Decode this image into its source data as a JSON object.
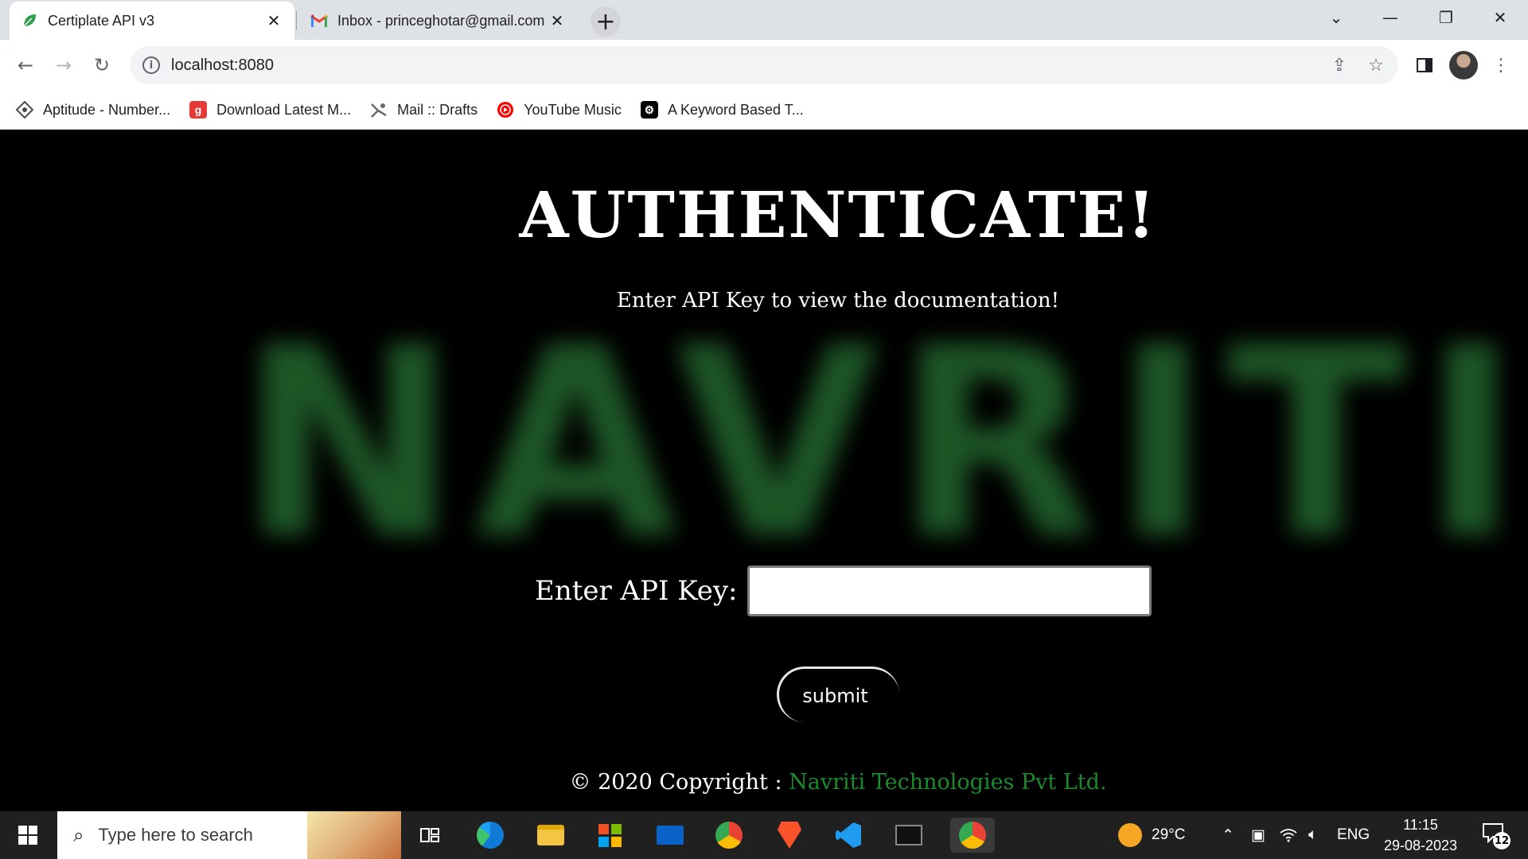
{
  "browser": {
    "tabs": [
      {
        "title": "Certiplate API v3",
        "icon": "leaf-icon",
        "active": true
      },
      {
        "title": "Inbox - princeghotar@gmail.com",
        "icon": "gmail-icon",
        "active": false
      }
    ],
    "new_tab_label": "+",
    "url": "localhost:8080",
    "bookmarks": [
      {
        "label": "Aptitude - Number...",
        "icon": "aptitude-icon",
        "color": "#4a4a4a"
      },
      {
        "label": "Download Latest M...",
        "icon": "g-icon",
        "color": "#e53935"
      },
      {
        "label": "Mail :: Drafts",
        "icon": "mail-icon",
        "color": "#6b6b6b"
      },
      {
        "label": "YouTube Music",
        "icon": "youtube-music-icon",
        "color": "#ff0000"
      },
      {
        "label": "A Keyword Based T...",
        "icon": "gear-icon",
        "color": "#000000"
      }
    ]
  },
  "page": {
    "watermark": "NAVRITI",
    "heading": "AUTHENTICATE!",
    "subheading": "Enter API Key to view the documentation!",
    "api_key_label": "Enter API Key:",
    "api_key_value": "",
    "submit_label": "submit",
    "footer_prefix": "© 2020 Copyright : ",
    "footer_company": "Navriti Technologies Pvt Ltd.",
    "accent_color": "#1b8a2e"
  },
  "taskbar": {
    "search_placeholder": "Type here to search",
    "weather": "29°C",
    "language": "ENG",
    "time": "11:15",
    "date": "29-08-2023",
    "notification_count": "12"
  }
}
